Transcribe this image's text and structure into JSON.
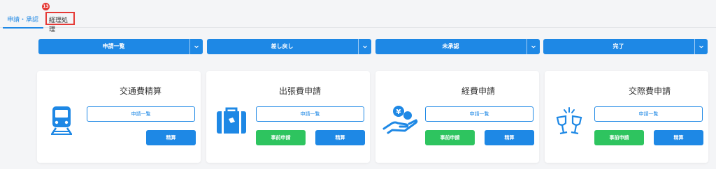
{
  "tabs": {
    "approval_label": "申請・承認",
    "accounting_label": "経理処理",
    "badge_count": "13"
  },
  "filters": [
    {
      "label": "申請一覧"
    },
    {
      "label": "差し戻し"
    },
    {
      "label": "未承認"
    },
    {
      "label": "完了"
    }
  ],
  "cards": [
    {
      "title": "交通費精算",
      "list_label": "申請一覧",
      "settle_label": "精算",
      "icon": "train-icon"
    },
    {
      "title": "出張費申請",
      "list_label": "申請一覧",
      "pre_label": "事前申請",
      "settle_label": "精算",
      "icon": "suitcase-icon"
    },
    {
      "title": "経費申請",
      "list_label": "申請一覧",
      "pre_label": "事前申請",
      "settle_label": "精算",
      "icon": "hand-coin-icon"
    },
    {
      "title": "交際費申請",
      "list_label": "申請一覧",
      "pre_label": "事前申請",
      "settle_label": "精算",
      "icon": "toast-glasses-icon"
    }
  ],
  "colors": {
    "accent": "#1e88e5",
    "green": "#2ec45f",
    "badge": "#e53935"
  }
}
